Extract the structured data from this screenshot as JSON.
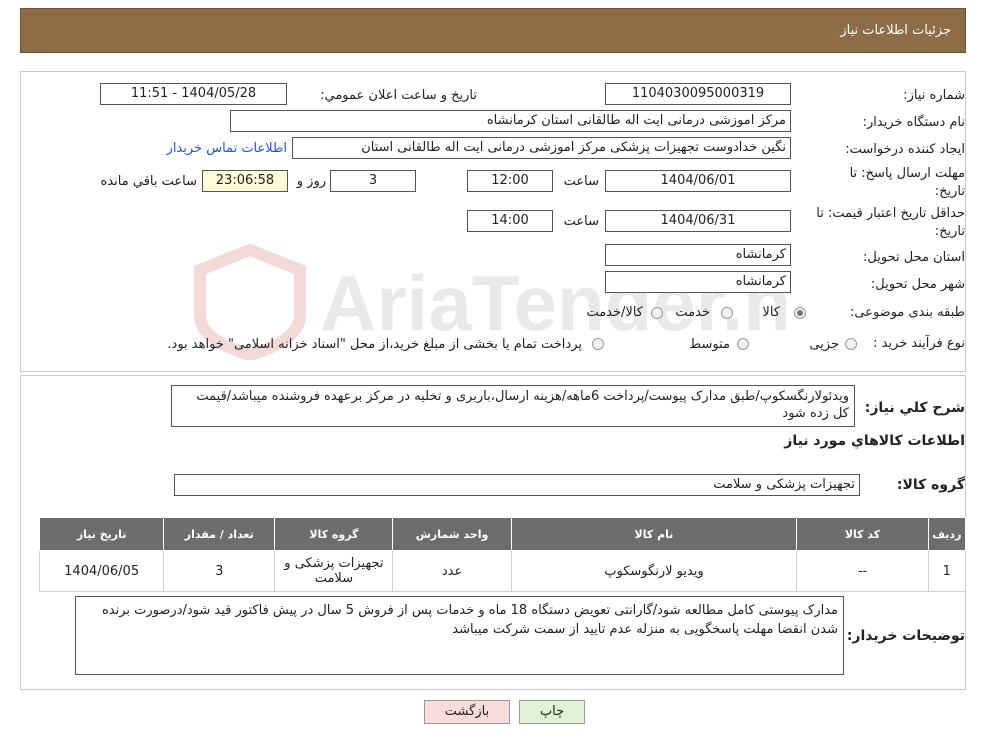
{
  "header": {
    "title": "جزئیات اطلاعات نیاز"
  },
  "form": {
    "need_number_label": "شماره نیاز:",
    "need_number": "1104030095000319",
    "announce_label": "تاريخ و ساعت اعلان عمومي:",
    "announce_value": "1404/05/28 - 11:51",
    "buyer_org_label": "نام دستگاه خریدار:",
    "buyer_org": "مرکز اموزشی درمانی ایت اله طالقانی استان کرمانشاه",
    "creator_label": "ایجاد کننده درخواست:",
    "creator": "نگین خدادوست تجهیزات پزشکی مرکز اموزشی درمانی ایت اله طالقانی استان",
    "contact_link": "اطلاعات تماس خریدار",
    "deadline_label_1": "مهلت ارسال پاسخ: تا",
    "deadline_label_2": "تاریخ:",
    "deadline_date": "1404/06/01",
    "time_label": "ساعت",
    "deadline_time": "12:00",
    "days_value": "3",
    "days_label": "روز و",
    "remaining_time": "23:06:58",
    "remaining_label": "ساعت باقي مانده",
    "validity_label_1": "حداقل تاریخ اعتبار قیمت: تا",
    "validity_label_2": "تاریخ:",
    "validity_date": "1404/06/31",
    "validity_time": "14:00",
    "province_label": "استان محل تحویل:",
    "province": "کرمانشاه",
    "city_label": "شهر محل تحویل:",
    "city": "کرمانشاه",
    "category_label": "طبقه بندی موضوعی:",
    "category_options": [
      "کالا",
      "خدمت",
      "کالا/خدمت"
    ],
    "category_selected": "کالا",
    "process_label": "نوع فرآیند خرید :",
    "process_options": [
      "جزیی",
      "متوسط"
    ],
    "process_note": "پرداخت تمام یا بخشی از مبلغ خرید،از محل \"اسناد خزانه اسلامی\" خواهد بود."
  },
  "description": {
    "label": "شرح کلي نياز:",
    "text": "ویدئولارنگسکوپ/طبق مدارک پیوست/پرداخت 6ماهه/هزینه ارسال،باربری و تخلیه در مرکز برعهده فروشنده میباشد/قیمت کل زده شود"
  },
  "goods": {
    "section_title": "اطلاعات کالاهاي مورد نياز",
    "group_label": "گروه کالا:",
    "group_value": "تجهیزات پزشکی و سلامت",
    "columns": [
      "رديف",
      "کد کالا",
      "نام کالا",
      "واحد شمارش",
      "گروه کالا",
      "تعداد / مقدار",
      "تاريخ نياز"
    ],
    "rows": [
      {
        "index": "1",
        "code": "--",
        "name": "ویدیو لارنگوسکوپ",
        "unit": "عدد",
        "group": "تجهیزات پزشکی و سلامت",
        "quantity": "3",
        "date": "1404/06/05"
      }
    ]
  },
  "buyer_notes": {
    "label": "توضیحات خریدار:",
    "text": "مدارک پیوستی کامل مطالعه شود/گارانتی تعویض دستگاه 18 ماه و خدمات پس از فروش 5 سال در پیش فاکتور قید شود/درصورت برنده شدن انقضا مهلت پاسخگویی به منزله عدم تایید از سمت شرکت میباشد"
  },
  "buttons": {
    "print": "چاپ",
    "back": "بازگشت"
  },
  "watermark": {
    "text": "AriaTender.neT"
  },
  "colors": {
    "header_bg": "#8c6d47",
    "table_header_bg": "#6d6d6d",
    "print_btn": "#dff3d6",
    "back_btn": "#fbdcdc"
  }
}
